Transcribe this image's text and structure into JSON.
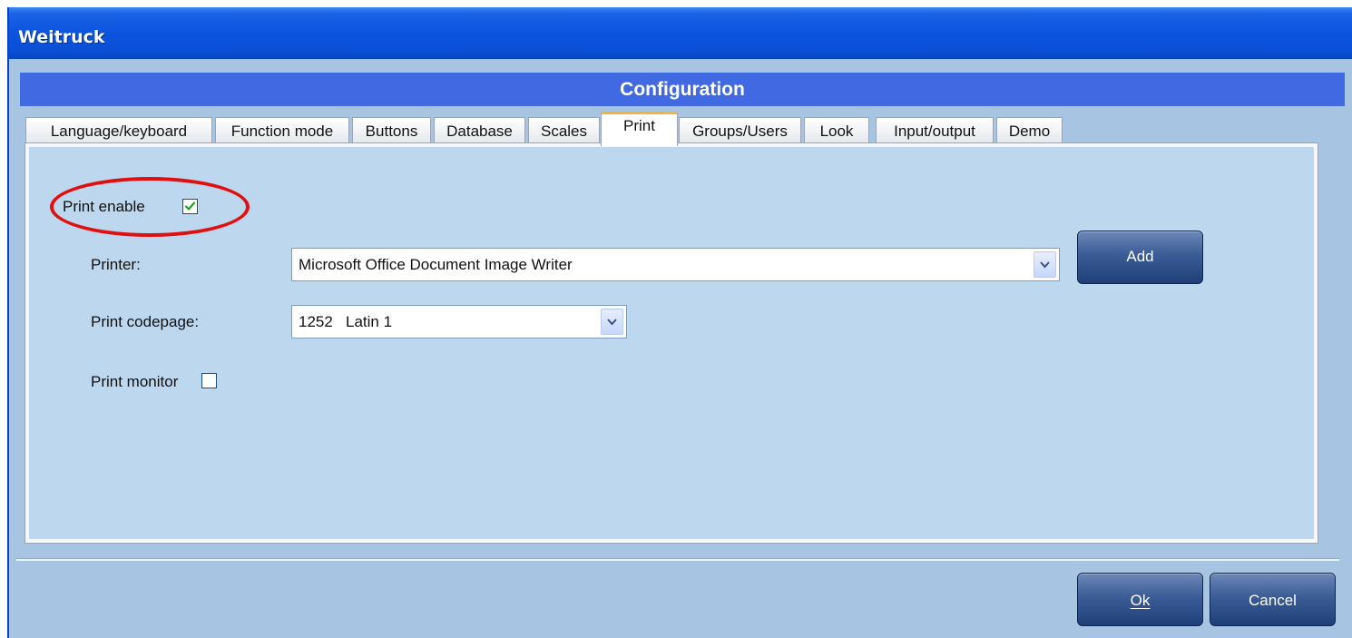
{
  "window": {
    "title": "Weitruck"
  },
  "header": {
    "title": "Configuration"
  },
  "tabs": [
    {
      "label": "Language/keyboard"
    },
    {
      "label": "Function mode"
    },
    {
      "label": "Buttons"
    },
    {
      "label": "Database"
    },
    {
      "label": "Scales"
    },
    {
      "label": "Print",
      "active": true
    },
    {
      "label": "Groups/Users"
    },
    {
      "label": "Look"
    },
    {
      "label": "Input/output"
    },
    {
      "label": "Demo"
    }
  ],
  "print": {
    "enable_label": "Print enable",
    "enable_checked": true,
    "printer_label": "Printer:",
    "printer_value": "Microsoft Office Document Image Writer",
    "add_button": "Add",
    "codepage_label": "Print codepage:",
    "codepage_value": "1252   Latin 1",
    "monitor_label": "Print monitor",
    "monitor_checked": false
  },
  "footer": {
    "ok_label": "Ok",
    "cancel_label": "Cancel"
  },
  "colors": {
    "title_bar": "#0b54de",
    "header": "#4169e1",
    "panel": "#bdd7ee",
    "annotation": "#e01010"
  }
}
